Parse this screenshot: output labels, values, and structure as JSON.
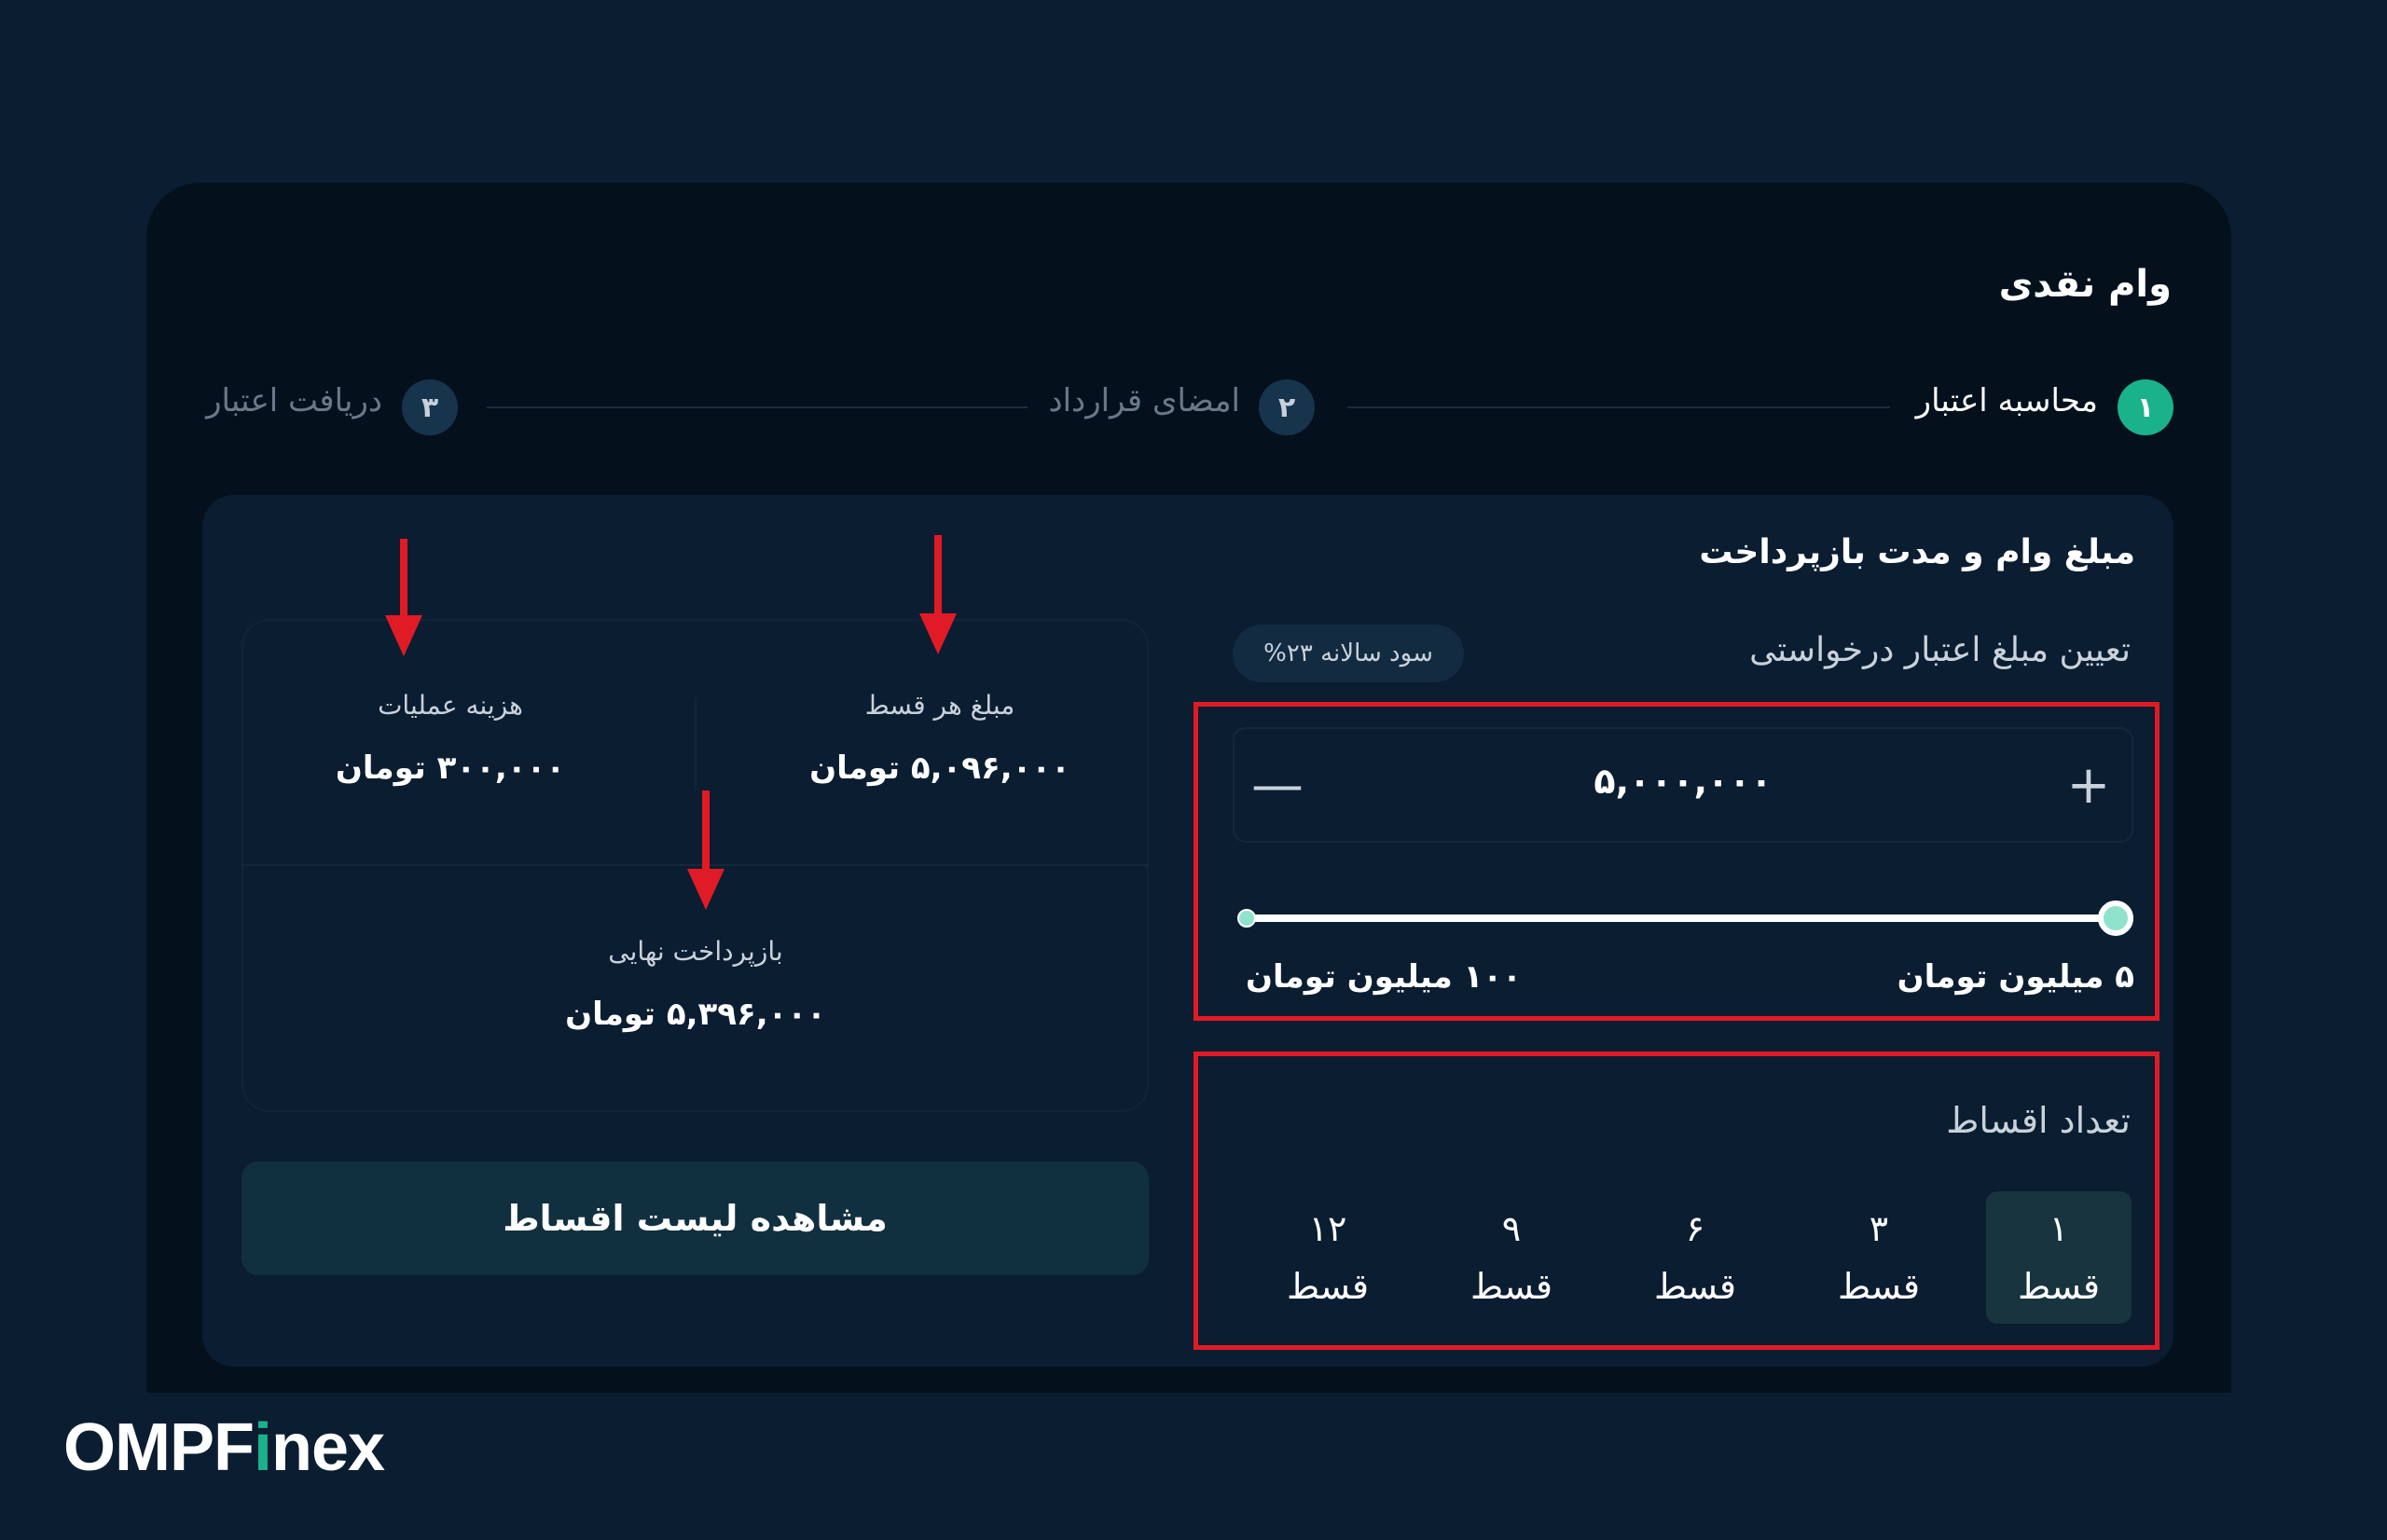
{
  "page": {
    "title": "وام نقدی"
  },
  "stepper": {
    "steps": [
      {
        "number": "۱",
        "label": "محاسبه اعتبار",
        "state": "active"
      },
      {
        "number": "۲",
        "label": "امضای قرارداد",
        "state": "inactive"
      },
      {
        "number": "۳",
        "label": "دریافت اعتبار",
        "state": "inactive"
      }
    ]
  },
  "loan_form": {
    "section_title": "مبلغ وام و مدت بازپرداخت",
    "amount_label": "تعیین مبلغ اعتبار درخواستی",
    "annual_rate": "سود سالانه ۲۳%",
    "amount_value": "۵,۰۰۰,۰۰۰",
    "minus_symbol": "—",
    "plus_symbol": "+",
    "slider": {
      "min_label": "۵ میلیون تومان",
      "max_label": "۱۰۰ میلیون تومان",
      "level": 1.0
    },
    "installments": {
      "label": "تعداد اقساط",
      "options": [
        {
          "count": "۱",
          "unit": "قسط",
          "selected": true
        },
        {
          "count": "۳",
          "unit": "قسط",
          "selected": false
        },
        {
          "count": "۶",
          "unit": "قسط",
          "selected": false
        },
        {
          "count": "۹",
          "unit": "قسط",
          "selected": false
        },
        {
          "count": "۱۲",
          "unit": "قسط",
          "selected": false
        }
      ]
    }
  },
  "summary": {
    "installment_amount": {
      "label": "مبلغ هر قسط",
      "value": "۵,۰۹۶,۰۰۰ تومان"
    },
    "operation_fee": {
      "label": "هزینه عملیات",
      "value": "۳۰۰,۰۰۰ تومان"
    },
    "final_repayment": {
      "label": "بازپرداخت نهایی",
      "value": "۵,۳۹۶,۰۰۰ تومان"
    }
  },
  "view_installments_button": "مشاهده لیست اقساط",
  "brand": {
    "name_prefix": "OMPF",
    "name_accent": "i",
    "name_suffix": "nex"
  },
  "colors": {
    "background": "#0b1d31",
    "card": "#04111d",
    "accent": "#1ab28a",
    "annotation": "#e11b25"
  }
}
